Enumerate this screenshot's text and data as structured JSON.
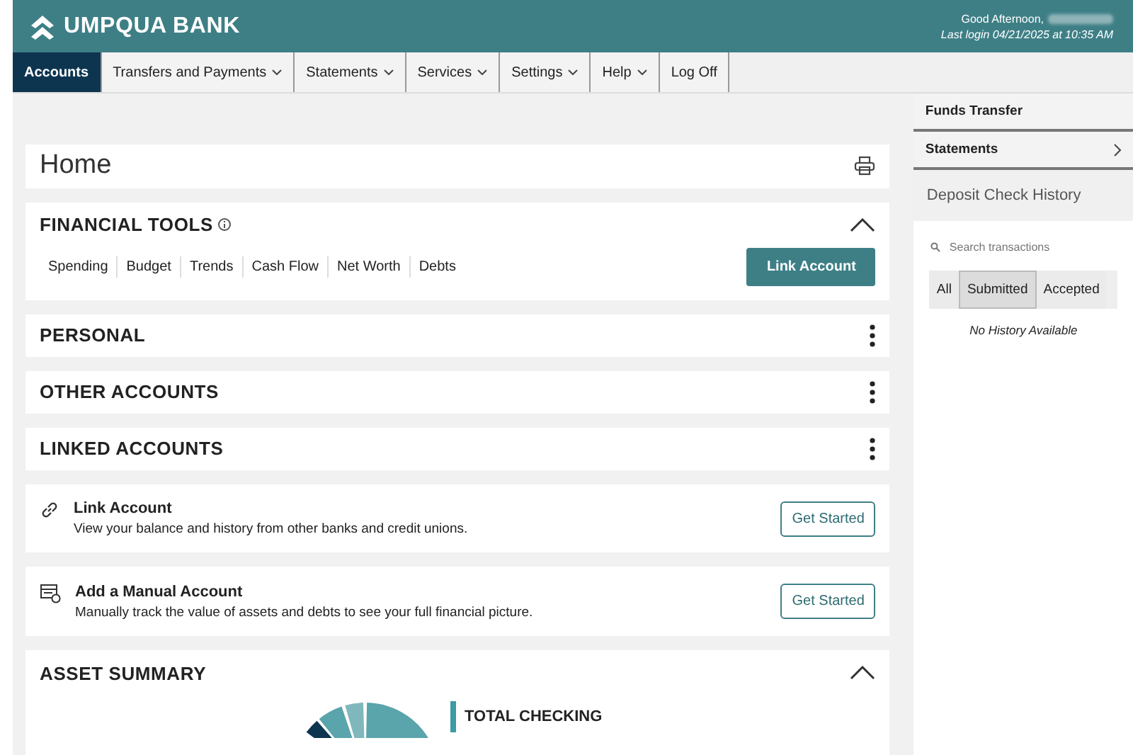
{
  "header": {
    "bank_name": "UMPQUA BANK",
    "greeting": "Good Afternoon,",
    "last_login": "Last login 04/21/2025 at 10:35 AM"
  },
  "nav": [
    {
      "label": "Accounts",
      "dropdown": false,
      "selected": true
    },
    {
      "label": "Transfers and Payments",
      "dropdown": true,
      "selected": false
    },
    {
      "label": "Statements",
      "dropdown": true,
      "selected": false
    },
    {
      "label": "Services",
      "dropdown": true,
      "selected": false
    },
    {
      "label": "Settings",
      "dropdown": true,
      "selected": false
    },
    {
      "label": "Help",
      "dropdown": true,
      "selected": false
    },
    {
      "label": "Log Off",
      "dropdown": false,
      "selected": false
    }
  ],
  "page_title": "Home",
  "financial_tools": {
    "title": "FINANCIAL TOOLS",
    "expanded": true,
    "tabs": [
      "Spending",
      "Budget",
      "Trends",
      "Cash Flow",
      "Net Worth",
      "Debts"
    ],
    "button": "Link Account"
  },
  "sections": [
    {
      "title": "PERSONAL"
    },
    {
      "title": "OTHER ACCOUNTS"
    },
    {
      "title": "LINKED ACCOUNTS"
    }
  ],
  "promos": [
    {
      "kind": "link",
      "title": "Link Account",
      "description": "View your balance and history from other banks and credit unions.",
      "button": "Get Started"
    },
    {
      "kind": "manual",
      "title": "Add a Manual Account",
      "description": "Manually track the value of assets and debts to see your full financial picture.",
      "button": "Get Started"
    }
  ],
  "asset_summary": {
    "title": "ASSET SUMMARY",
    "expanded": true,
    "legend_title": "TOTAL CHECKING"
  },
  "sidebar": {
    "items": [
      {
        "label": "Funds Transfer",
        "kind": "plain"
      },
      {
        "label": "Statements",
        "kind": "chevron"
      }
    ],
    "deposit": {
      "title": "Deposit Check History",
      "search_placeholder": "Search transactions",
      "filters": [
        {
          "label": "All",
          "selected": false
        },
        {
          "label": "Submitted",
          "selected": true
        },
        {
          "label": "Accepted",
          "selected": false
        }
      ],
      "empty_text": "No History Available"
    }
  }
}
